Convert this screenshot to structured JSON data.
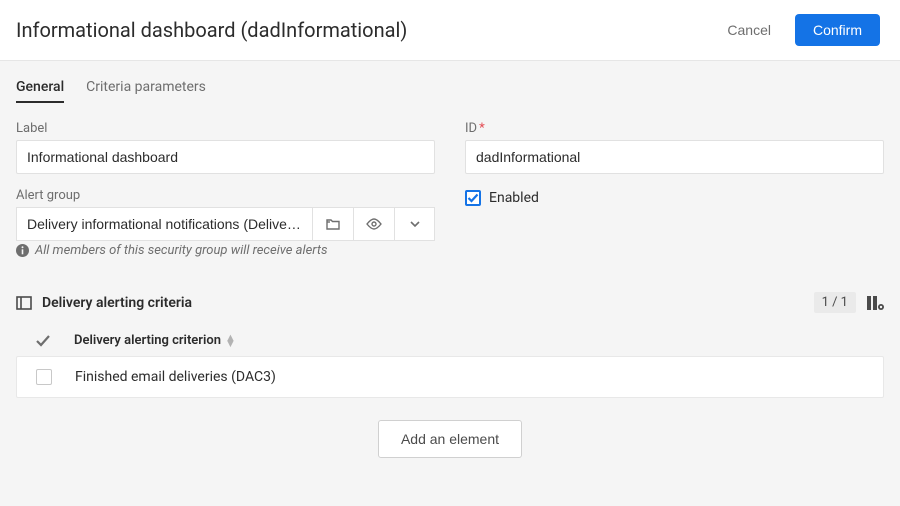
{
  "header": {
    "title": "Informational dashboard (dadInformational)",
    "cancel": "Cancel",
    "confirm": "Confirm"
  },
  "tabs": {
    "general": "General",
    "criteria": "Criteria parameters"
  },
  "form": {
    "label_field_label": "Label",
    "label_value": "Informational dashboard",
    "id_field_label": "ID",
    "id_value": "dadInformational",
    "alert_group_label": "Alert group",
    "alert_group_value": "Delivery informational notifications (Delivery n …",
    "helper_text": "All members of this security group will receive alerts",
    "enabled_label": "Enabled",
    "enabled_checked": true
  },
  "criteria": {
    "section_title": "Delivery alerting criteria",
    "pager": "1 / 1",
    "column_header": "Delivery alerting criterion",
    "rows": [
      {
        "label": "Finished email deliveries (DAC3)",
        "checked": false
      }
    ],
    "add_button": "Add an element"
  },
  "icons": {
    "folder": "folder-icon",
    "eye": "eye-icon",
    "chevron_down": "chevron-down-icon",
    "info": "info-icon",
    "layout": "layout-icon",
    "columns_settings": "columns-settings-icon",
    "check_header": "check-icon",
    "sort": "sort-icon"
  }
}
